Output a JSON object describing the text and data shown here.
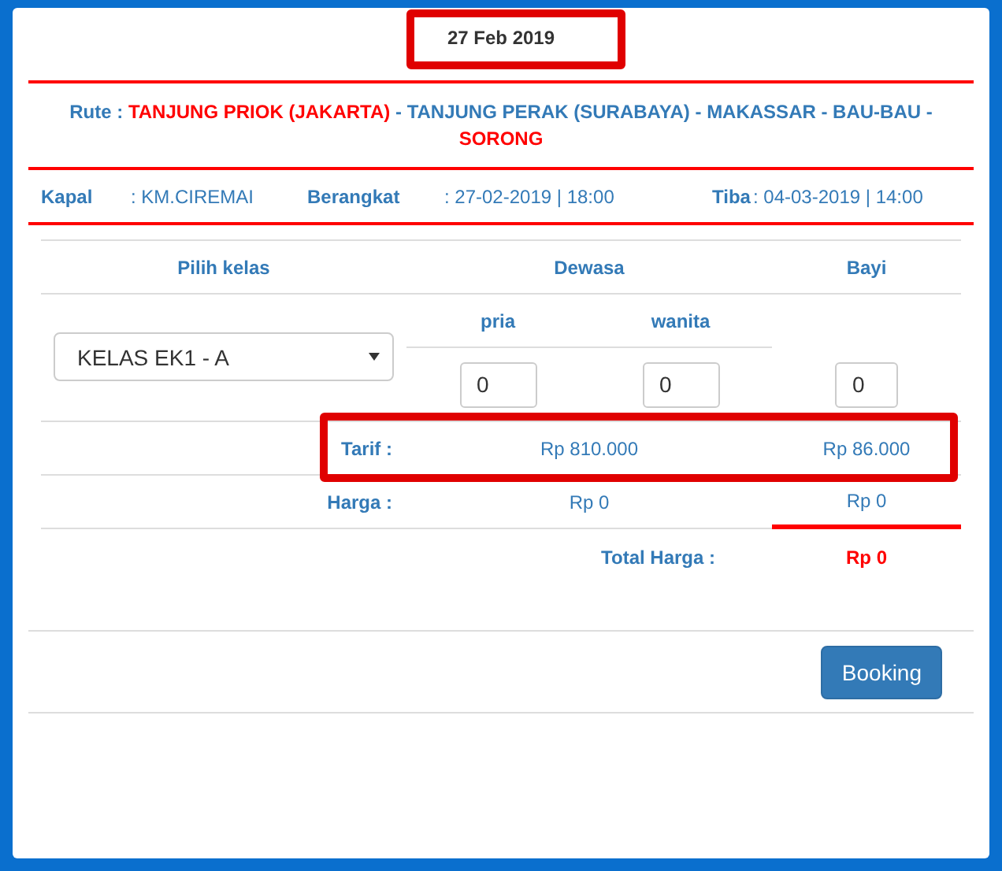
{
  "date": {
    "text": "27 Feb 2019",
    "highlighted": true
  },
  "route": {
    "label": "Rute :",
    "parts": [
      {
        "text": "TANJUNG PRIOK (JAKARTA)",
        "highlighted": true
      },
      {
        "text": " - TANJUNG PERAK (SURABAYA) - MAKASSAR - BAU-BAU - ",
        "highlighted": false
      },
      {
        "text": "SORONG",
        "highlighted": true
      }
    ]
  },
  "info": [
    {
      "label": "Kapal",
      "value": ": KM.CIREMAI"
    },
    {
      "label": "Berangkat",
      "value": ": 27-02-2019 | 18:00"
    },
    {
      "label": "Tiba",
      "value": ": 04-03-2019 | 14:00"
    }
  ],
  "table": {
    "headers": [
      "Pilih kelas",
      "Dewasa",
      "Bayi"
    ],
    "subheaders": [
      "pria",
      "wanita"
    ],
    "class_select": {
      "value": "KELAS EK1 - A"
    },
    "inputs": [
      {
        "value": "0"
      },
      {
        "value": "0"
      },
      {
        "value": "0"
      }
    ],
    "tarif": {
      "label": "Tarif :",
      "adult": "Rp 810.000",
      "infant": "Rp 86.000",
      "highlighted": true
    },
    "harga": {
      "label": "Harga :",
      "adult": "Rp 0",
      "infant": "Rp 0"
    },
    "total": {
      "label": "Total Harga :",
      "value": "Rp 0"
    }
  },
  "button": "Booking"
}
